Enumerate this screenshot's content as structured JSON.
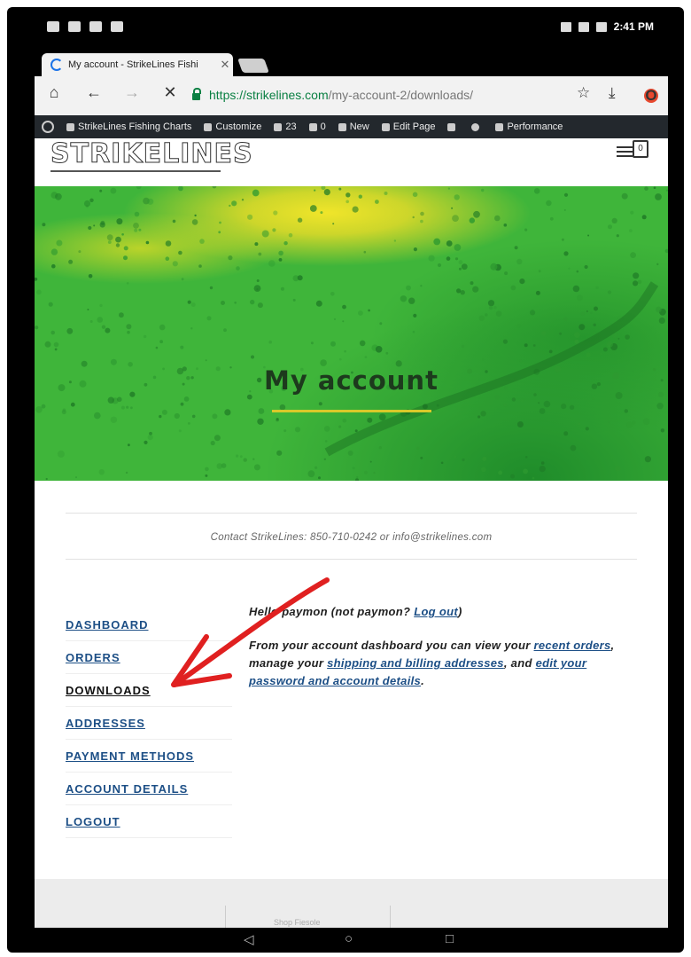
{
  "status_bar": {
    "time": "2:41 PM"
  },
  "browser": {
    "tab_title": "My account - StrikeLines Fishi",
    "tab_close": "✕",
    "url_scheme": "https://",
    "url_host": "strikelines.com",
    "url_path": "/my-account-2/downloads/"
  },
  "admin_bar": {
    "site_name": "StrikeLines Fishing Charts",
    "customize": "Customize",
    "updates_count": "23",
    "comments_count": "0",
    "new": "New",
    "edit_page": "Edit Page",
    "performance": "Performance"
  },
  "site": {
    "logo_text": "STRIKELINES",
    "cart_count": "0"
  },
  "hero": {
    "title": "My account"
  },
  "contact_line": "Contact StrikeLines: 850-710-0242 or info@strikelines.com",
  "account_nav": [
    {
      "label": "DASHBOARD"
    },
    {
      "label": "ORDERS"
    },
    {
      "label": "DOWNLOADS"
    },
    {
      "label": "ADDRESSES"
    },
    {
      "label": "PAYMENT METHODS"
    },
    {
      "label": "ACCOUNT DETAILS"
    },
    {
      "label": "LOGOUT"
    }
  ],
  "welcome": {
    "hello_prefix": "Hello paymon (not paymon? ",
    "logout_link": "Log out",
    "hello_suffix": ")",
    "p2_prefix": "From your account dashboard you can view your ",
    "recent_orders_link": "recent orders",
    "p2_mid": ", manage your ",
    "addresses_link": "shipping and billing addresses",
    "p2_mid2": ", and ",
    "account_link": "edit your password and account details",
    "p2_suffix": "."
  },
  "footer": {
    "text": "Shop Fiesole"
  },
  "colors": {
    "link": "#1d4f86",
    "admin_bar": "#23282d",
    "hero_underline": "#d8c92a",
    "arrow": "#e02020"
  }
}
